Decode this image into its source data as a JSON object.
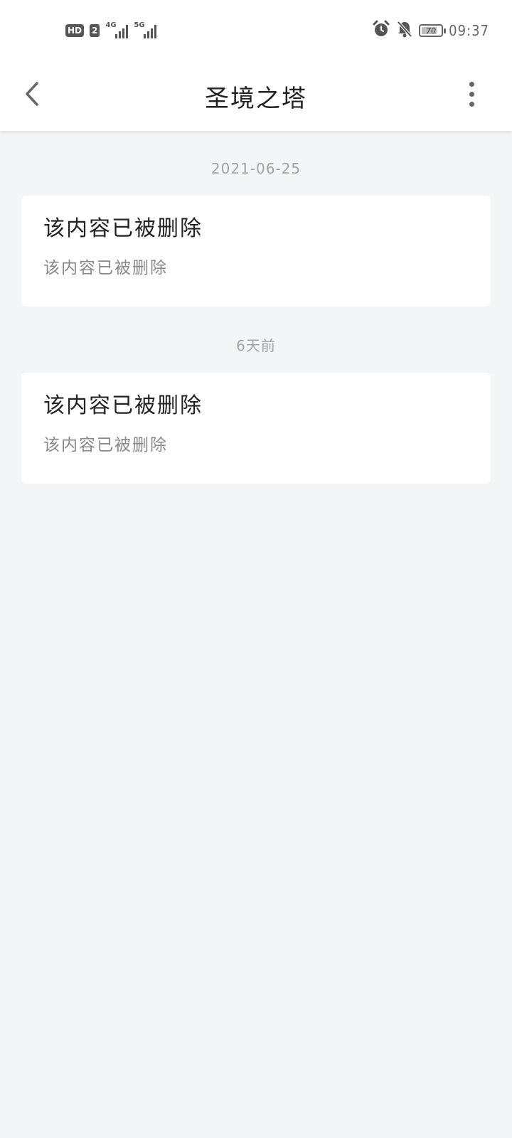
{
  "status_bar": {
    "hd_badge": "HD",
    "sim_badge": "2",
    "network_1": "4G",
    "network_2": "5G",
    "battery_level": "70",
    "time": "09:37",
    "icons": [
      "alarm-icon",
      "mute-bell-icon",
      "battery-icon"
    ]
  },
  "header": {
    "title": "圣境之塔",
    "back_icon": "chevron-left-icon",
    "more_icon": "more-vertical-icon"
  },
  "feed": {
    "items": [
      {
        "time": "2021-06-25",
        "title": "该内容已被删除",
        "body": "该内容已被删除"
      },
      {
        "time": "6天前",
        "title": "该内容已被删除",
        "body": "该内容已被删除"
      }
    ]
  },
  "colors": {
    "background": "#f4f5f7",
    "card": "#ffffff",
    "title_text": "#222222",
    "secondary_text": "#888888",
    "timestamp_text": "#a3a3a3"
  }
}
